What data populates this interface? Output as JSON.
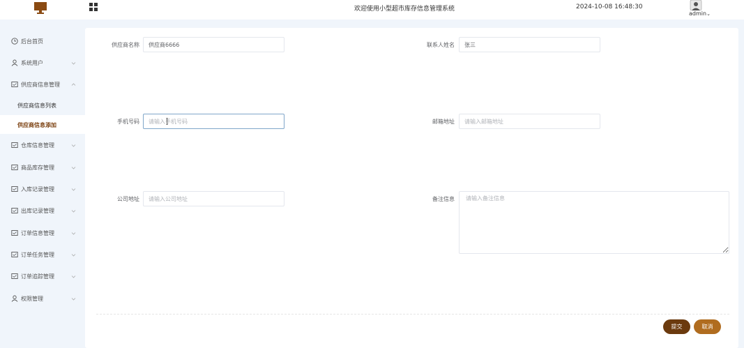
{
  "header": {
    "title": "欢迎使用小型超市库存信息管理系统",
    "datetime": "2024-10-08 16:48:30",
    "username": "admin"
  },
  "sidebar": {
    "items": [
      {
        "label": "后台首页",
        "icon": "clock-icon"
      },
      {
        "label": "系统用户",
        "icon": "user-icon"
      },
      {
        "label": "供应商信息管理",
        "icon": "window-icon"
      },
      {
        "label": "仓库信息管理",
        "icon": "window-icon"
      },
      {
        "label": "商品库存管理",
        "icon": "window-icon"
      },
      {
        "label": "入库记录管理",
        "icon": "window-icon"
      },
      {
        "label": "出库记录管理",
        "icon": "window-icon"
      },
      {
        "label": "订单信息管理",
        "icon": "window-icon"
      },
      {
        "label": "订单任务管理",
        "icon": "window-icon"
      },
      {
        "label": "订单追踪管理",
        "icon": "window-icon"
      },
      {
        "label": "权限管理",
        "icon": "user-icon"
      }
    ],
    "subitems": [
      {
        "label": "供应商信息列表"
      },
      {
        "label": "供应商信息添加"
      }
    ]
  },
  "form": {
    "supplier_name": {
      "label": "供应商名称",
      "value": "供应商6666",
      "placeholder": ""
    },
    "contact_name": {
      "label": "联系人姓名",
      "value": "张三",
      "placeholder": ""
    },
    "phone": {
      "label": "手机号码",
      "value": "",
      "placeholder": "请输入手机号码"
    },
    "email": {
      "label": "邮箱地址",
      "value": "",
      "placeholder": "请输入邮箱地址"
    },
    "address": {
      "label": "公司地址",
      "value": "",
      "placeholder": "请输入公司地址"
    },
    "remark": {
      "label": "备注信息",
      "value": "",
      "placeholder": "请输入备注信息"
    },
    "submit_label": "提交",
    "cancel_label": "取消"
  },
  "colors": {
    "accent": "#6b3a0e",
    "cancel": "#b06c1f",
    "active_text": "#7a3f0e"
  }
}
